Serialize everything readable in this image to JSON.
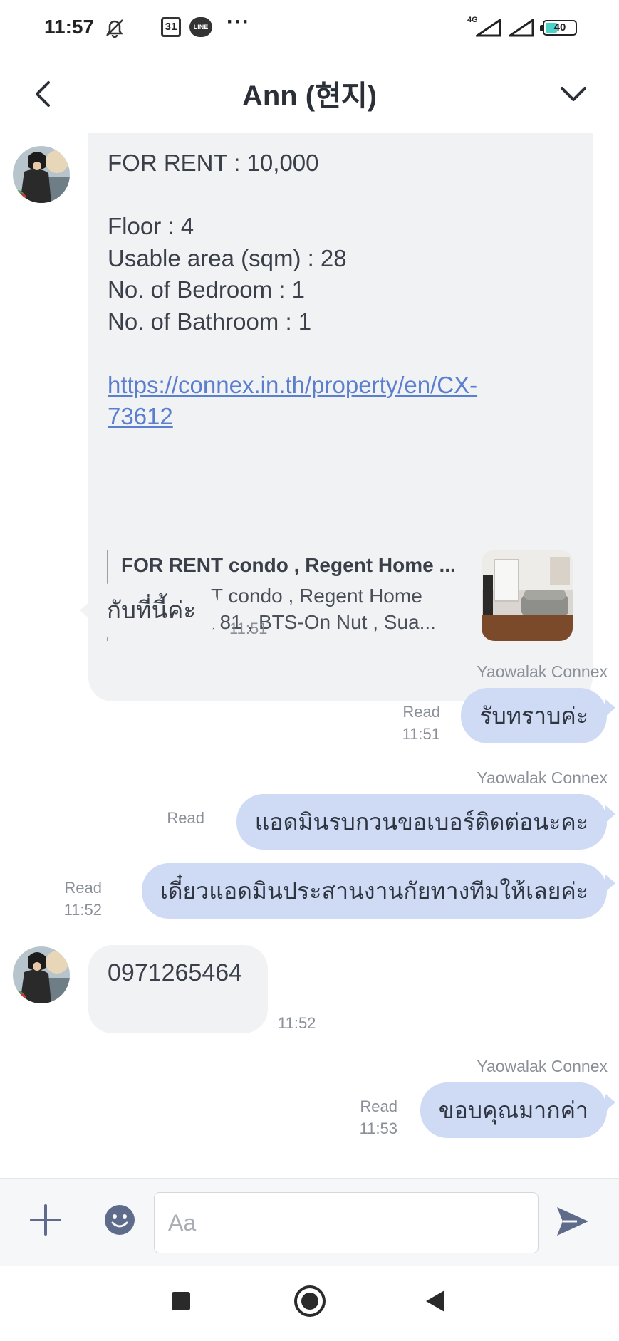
{
  "status_bar": {
    "time": "11:57",
    "calendar_day": "31",
    "line_badge": "LINE",
    "more": "···",
    "network": "4G",
    "battery": "40"
  },
  "header": {
    "title": "Ann (현지)",
    "back_icon": "chevron-left-icon",
    "menu_icon": "chevron-down-icon"
  },
  "messages": {
    "listing": {
      "price": "FOR RENT : 10,000",
      "floor": "Floor :  4",
      "area": "Usable area (sqm) :  28",
      "bedroom": "No. of Bedroom : 1",
      "bathroom": "No. of Bathroom : 1",
      "link_line1": "https://connex.in.th/property/en/CX-",
      "link_line2": "73612",
      "preview_title": "FOR RENT condo , Regent Home ...",
      "preview_desc_line1": "FOR RENT condo , Regent Home",
      "preview_desc_line2": "Sukhumvit 81 , BTS-On Nut , Sua..."
    },
    "in1": {
      "text": "กับที่นี้ค่ะ",
      "time": "11:51"
    },
    "out1": {
      "sender": "Yaowalak Connex",
      "text": "รับทราบค่ะ",
      "status": "Read",
      "time": "11:51"
    },
    "out2": {
      "sender": "Yaowalak Connex",
      "text": "แอดมินรบกวนขอเบอร์ติดต่อนะคะ",
      "status": "Read"
    },
    "out3": {
      "text": "เดี๋ยวแอดมินประสานงานกัยทางทีมให้เลยค่ะ",
      "status": "Read",
      "time": "11:52"
    },
    "in2": {
      "text": "0971265464",
      "time": "11:52"
    },
    "out4": {
      "sender": "Yaowalak Connex",
      "text": "ขอบคุณมากค่า",
      "status": "Read",
      "time": "11:53"
    }
  },
  "input": {
    "placeholder": "Aa",
    "value": ""
  },
  "colors": {
    "outgoing_bubble": "#cfdbf5",
    "incoming_bubble": "#f1f2f4",
    "link": "#5b7fce",
    "icon": "#5f6b8a"
  }
}
